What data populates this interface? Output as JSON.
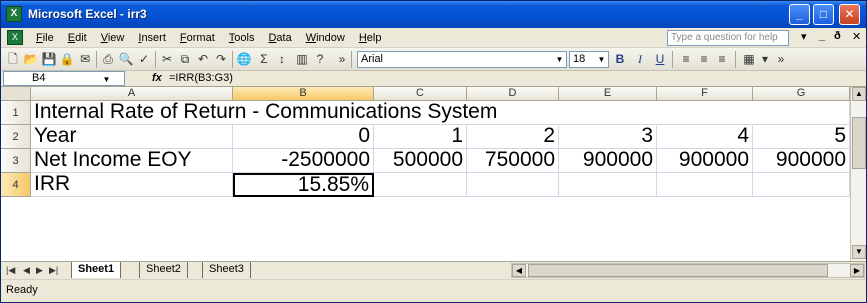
{
  "window": {
    "title": "Microsoft Excel - irr3",
    "app_icon": "excel-icon"
  },
  "menu": {
    "items": [
      "File",
      "Edit",
      "View",
      "Insert",
      "Format",
      "Tools",
      "Data",
      "Window",
      "Help"
    ],
    "help_placeholder": "Type a question for help"
  },
  "toolbar": {
    "font_name": "Arial",
    "font_size": "18",
    "bold": "B",
    "italic": "I",
    "underline": "U"
  },
  "formula_bar": {
    "name_box": "B4",
    "fx": "fx",
    "formula": "=IRR(B3:G3)"
  },
  "columns": [
    "A",
    "B",
    "C",
    "D",
    "E",
    "F",
    "G"
  ],
  "rows": [
    {
      "number": "1",
      "cells": [
        "Internal Rate of Return - Communications System",
        "",
        "",
        "",
        "",
        "",
        ""
      ]
    },
    {
      "number": "2",
      "cells": [
        "Year",
        "0",
        "1",
        "2",
        "3",
        "4",
        "5"
      ]
    },
    {
      "number": "3",
      "cells": [
        "Net Income EOY",
        "-2500000",
        "500000",
        "750000",
        "900000",
        "900000",
        "900000"
      ]
    },
    {
      "number": "4",
      "cells": [
        "IRR",
        "15.85%",
        "",
        "",
        "",
        "",
        ""
      ]
    }
  ],
  "selected_cell": "B4",
  "sheet_tabs": [
    "Sheet1",
    "Sheet2",
    "Sheet3"
  ],
  "active_sheet": "Sheet1",
  "status": "Ready"
}
